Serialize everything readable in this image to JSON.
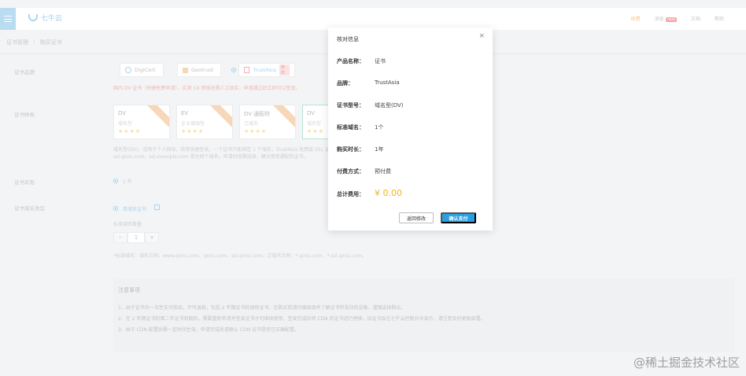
{
  "topbar": {
    "brand": "七牛云",
    "right_items": [
      "续费",
      "消息",
      "文档",
      "帮助"
    ],
    "new_badge": "new"
  },
  "breadcrumb": [
    "证书管理",
    "购买证书"
  ],
  "form": {
    "brand_label": "证书品牌",
    "brands": [
      "DigiCert",
      "Geotrust",
      "TrustAsia"
    ],
    "brand_tag": "推荐",
    "brand_hint": "国内 DV 证书（快捷免费申请），实测 CA 审核无需人工核实，申请通过后立即可以签发。",
    "type_label": "证书种类",
    "cert_cards": [
      {
        "title": "DV",
        "sub": "域名型",
        "stars": "★★★★"
      },
      {
        "title": "EV",
        "sub": "企业增强型",
        "stars": "★★★★"
      },
      {
        "title": "DV 通配符",
        "sub": "泛域名",
        "stars": "★★★★"
      },
      {
        "title": "DV",
        "sub": "域名型",
        "stars": "★★★"
      }
    ],
    "type_hint_1": "域名型(DV)，适用于个人网站，简单快速签发，一个证书只能绑定 1 个域名，TrustAsia 免费版 SSL 证书（一年期）",
    "type_hint_2": "ssl.qiniu.com，ssl.example.com 视为两个域名。申请时按需选择，建议使用通配符证书。",
    "duration_label": "证书年限",
    "duration_value": "1 年",
    "domain_type_label": "证书域名类型",
    "domain_type_value": "单域名证书",
    "domain_count_label": "标准域名数量",
    "stepper": {
      "minus": "−",
      "value": "1",
      "plus": "+"
    },
    "domain_example": "*标准域名：域名示例，www.qiniu.com、qiniu.com、ssl.qiniu.com；泛域名示例：*.qiniu.com、*.ssl.qiniu.com。"
  },
  "notice": {
    "title": "注意事项",
    "lines": [
      "1、由于证书为一次性支付商品，不可退款，包括 2 年期证书的保修证书，在购买前请仔细阅读并了解证书所支持的设备，谨慎选择购买。",
      "2、在 2 年期证书的第二年证书到期后，需要重新申请并签发证书才可继续使用，签发完成后将 CDN 的证书进行替换，旧证书会在七牛云控制台中显示，请注意及时更新部署。",
      "3、由于 CDN 配置后需一定时间生效，申请完成后请确认 CDN 证书是否已正确配置。"
    ]
  },
  "modal": {
    "title": "核对信息",
    "close": "×",
    "rows": [
      {
        "key": "产品名称：",
        "value": "证书"
      },
      {
        "key": "品牌：",
        "value": "TrustAsia"
      },
      {
        "key": "证书型号：",
        "value": "域名型(DV)"
      },
      {
        "key": "标准域名：",
        "value": "1个"
      },
      {
        "key": "购买时长：",
        "value": "1年"
      },
      {
        "key": "付费方式：",
        "value": "预付费"
      }
    ],
    "total_key": "总计费用：",
    "total_value": "¥ 0.00",
    "back_label": "返回修改",
    "pay_label": "确认支付"
  },
  "watermark": "@稀土掘金技术社区",
  "colors": {
    "accent": "#2aa0e4",
    "price": "#f2b61b"
  }
}
